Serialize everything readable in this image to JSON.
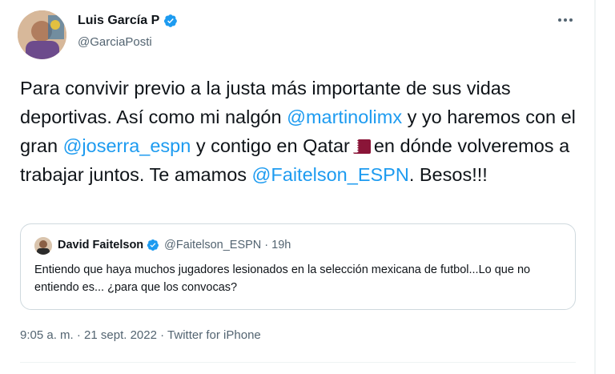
{
  "tweet": {
    "author_name": "Luis García P",
    "author_handle": "@GarciaPosti",
    "text_parts": [
      "Para convivir previo a la justa más importante de sus vidas deportivas. Así como mi nalgón ",
      "@martinolimx",
      " y yo haremos con el gran ",
      "@joserra_espn",
      " y contigo en Qatar",
      "en dónde volveremos a trabajar juntos. Te amamos ",
      "@Faitelson_ESPN",
      ". Besos!!!"
    ],
    "more_icon": "more-horizontal-icon",
    "flag_icon": "qatar-flag-icon"
  },
  "quote": {
    "author_name": "David Faitelson",
    "author_handle": "@Faitelson_ESPN",
    "separator": "·",
    "time": "19h",
    "text": "Entiendo que haya muchos jugadores lesionados en la selección mexicana de futbol...Lo que no entiendo es... ¿para que los convocas?"
  },
  "meta": {
    "time": "9:05 a. m.",
    "sep1": " · ",
    "date": "21 sept. 2022",
    "sep2": " · ",
    "source": "Twitter for iPhone"
  },
  "colors": {
    "accent": "#1d9bf0",
    "text": "#0f1419",
    "secondary": "#536471",
    "border": "#cfd9de",
    "qatar_maroon": "#8a1538"
  }
}
